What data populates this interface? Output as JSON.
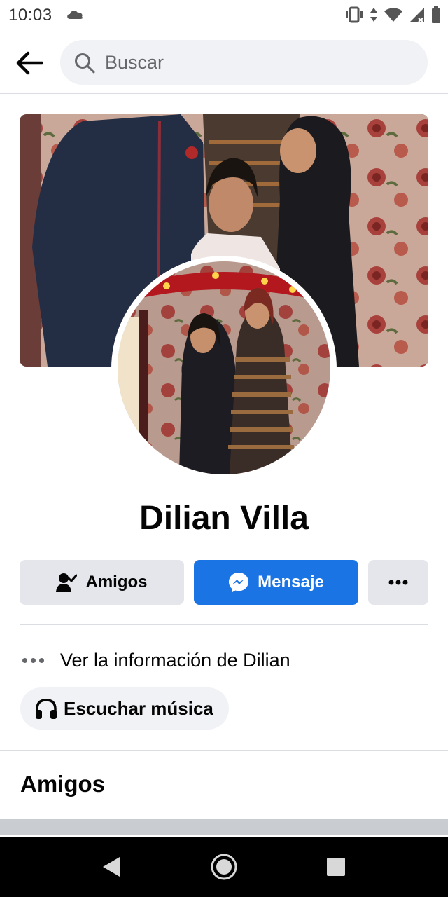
{
  "status_bar": {
    "time": "10:03",
    "icons": [
      "cloud-icon",
      "vibrate-icon",
      "data-arrows-icon",
      "wifi-icon",
      "signal-icon",
      "battery-icon"
    ]
  },
  "header": {
    "search_placeholder": "Buscar"
  },
  "profile": {
    "name": "Dilian Villa"
  },
  "actions": {
    "friends_label": "Amigos",
    "message_label": "Mensaje",
    "more_label": "•••"
  },
  "info": {
    "see_info_label": "Ver la información de Dilian",
    "music_label": "Escuchar música"
  },
  "sections": {
    "friends_title": "Amigos"
  },
  "colors": {
    "accent": "#1b74e4",
    "button_gray": "#e4e6eb",
    "search_bg": "#f0f2f5",
    "text_primary": "#050505",
    "text_secondary": "#65676b"
  }
}
